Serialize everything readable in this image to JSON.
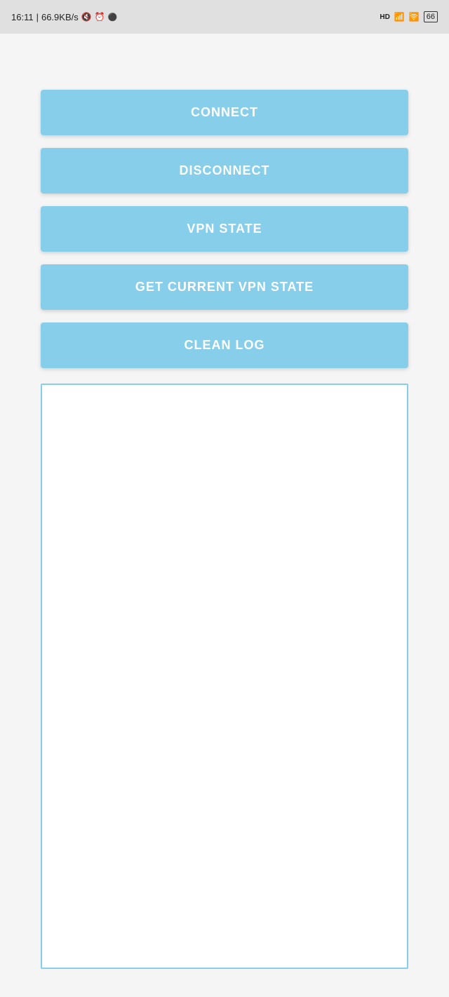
{
  "statusBar": {
    "time": "16:11",
    "speed": "66.9KB/s",
    "battery": "66",
    "icons": {
      "mute": "🔇",
      "alarm": "⏰",
      "record": "⚫",
      "signal": "HD",
      "wifi": "📶"
    }
  },
  "buttons": {
    "connect": "CONNECT",
    "disconnect": "DISCONNECT",
    "vpnState": "VPN STATE",
    "getCurrentVpnState": "GET CURRENT VPN STATE",
    "cleanLog": "CLEAN LOG"
  },
  "logArea": {
    "placeholder": ""
  }
}
